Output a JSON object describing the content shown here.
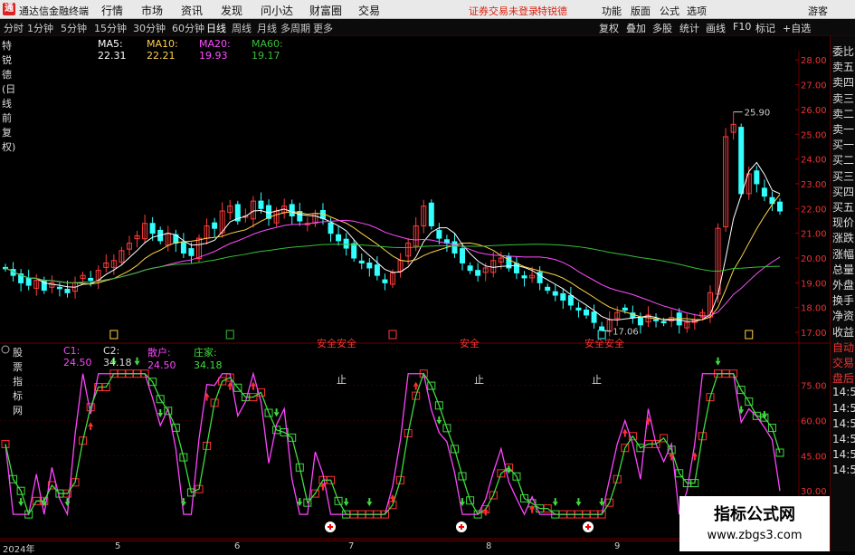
{
  "titlebar": {
    "app_name": "通达信金融终端",
    "menu": [
      "行情",
      "市场",
      "资讯",
      "发现",
      "问小达",
      "财富圈",
      "交易"
    ],
    "notice": "证券交易未登录",
    "stock": "特锐德",
    "right": [
      "功能",
      "版面",
      "公式",
      "选项"
    ],
    "guest": "游客"
  },
  "periods": [
    "分时",
    "1分钟",
    "5分钟",
    "15分钟",
    "30分钟",
    "60分钟",
    "日线",
    "周线",
    "月线",
    "多周期",
    "更多"
  ],
  "active_period": "日线",
  "right_tabs": [
    "复权",
    "叠加",
    "多股",
    "统计",
    "画线",
    "F10",
    "标记",
    "+自选"
  ],
  "kline_header": {
    "name": "特锐德(日线 前复权)",
    "ma5": "MA5: 22.31",
    "ma10": "MA10: 22.21",
    "ma20": "MA20: 19.93",
    "ma60": "MA60: 19.17"
  },
  "indicator_header": {
    "name": "股票指标网",
    "c1": "C1: 24.50",
    "c2": "C2: 34.18",
    "retail": "散户: 24.50",
    "banker": "庄家: 34.18"
  },
  "price_axis": [
    "28.00",
    "27.00",
    "26.00",
    "25.00",
    "24.00",
    "23.00",
    "22.00",
    "21.00",
    "20.00",
    "19.00",
    "18.00",
    "17.00"
  ],
  "ind_axis": [
    "75.00",
    "60.00",
    "45.00",
    "30.00"
  ],
  "annotations": {
    "high": "25.90",
    "low": "17.06",
    "ind_labels": [
      "安全安全",
      "安全",
      "安全安全",
      "止",
      "止",
      "止"
    ]
  },
  "right_panel": [
    "委比",
    "卖五",
    "卖四",
    "卖三",
    "卖二",
    "卖一",
    "买一",
    "买二",
    "买三",
    "买四",
    "买五",
    "现价",
    "涨跌",
    "涨幅",
    "总量",
    "外盘",
    "换手",
    "净资",
    "收益",
    "自动",
    "交易",
    "盘后",
    "14:5",
    "14:5",
    "14:5",
    "14:5",
    "14:5",
    "14:5"
  ],
  "dates": [
    "2024年",
    "5",
    "6",
    "7",
    "8",
    "9"
  ],
  "watermark": {
    "line1": "指标公式网",
    "line2": "www.zbgs3.com"
  },
  "colors": {
    "up": "#ff3c3c",
    "down": "#3ff",
    "ma5": "#ffffff",
    "ma10": "#ffd24a",
    "ma20": "#ff4cff",
    "ma60": "#38c038",
    "retail": "#ff44ff",
    "banker": "#3fdc3f"
  },
  "chart_data": {
    "type": "candlestick",
    "ylim": [
      16.6,
      28.3
    ],
    "closes": [
      19.6,
      19.3,
      19.0,
      18.9,
      19.1,
      18.7,
      19.0,
      18.8,
      18.6,
      19.0,
      19.3,
      19.1,
      19.5,
      19.8,
      19.9,
      20.3,
      20.6,
      20.9,
      21.4,
      21.0,
      20.7,
      21.0,
      20.6,
      20.2,
      20.1,
      20.8,
      21.3,
      21.2,
      21.9,
      22.1,
      21.5,
      21.7,
      22.3,
      22.0,
      21.6,
      21.9,
      22.1,
      21.7,
      21.5,
      21.4,
      21.8,
      21.6,
      21.0,
      20.7,
      20.4,
      20.0,
      19.8,
      19.6,
      19.3,
      19.0,
      19.4,
      19.9,
      20.6,
      21.3,
      22.1,
      21.3,
      20.8,
      20.6,
      20.2,
      19.8,
      19.5,
      19.3,
      19.6,
      19.9,
      20.0,
      19.6,
      19.4,
      19.2,
      19.3,
      19.0,
      18.7,
      18.5,
      18.3,
      18.1,
      17.9,
      17.7,
      17.4,
      17.1,
      17.5,
      17.8,
      17.9,
      17.6,
      17.3,
      17.7,
      17.5,
      17.4,
      17.6,
      17.3,
      17.4,
      17.5,
      17.8,
      18.6,
      21.2,
      24.9,
      25.4,
      22.6,
      23.4,
      23.0,
      22.5,
      22.2,
      21.9
    ]
  }
}
